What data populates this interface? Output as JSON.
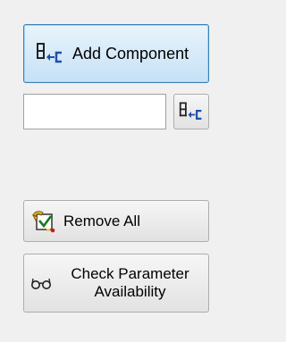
{
  "add_component": {
    "label": "Add Component",
    "icon": "add-component-icon"
  },
  "component_input": {
    "value": "",
    "placeholder": ""
  },
  "small_add": {
    "icon": "add-component-icon"
  },
  "remove_all": {
    "label": "Remove All",
    "icon": "remove-all-icon"
  },
  "check_parameter": {
    "label": "Check Parameter\nAvailability",
    "icon": "glasses-icon"
  },
  "colors": {
    "background": "#f0f0f0",
    "primary_button": "#c5e1f6",
    "icon_blue": "#1f4fa8"
  }
}
